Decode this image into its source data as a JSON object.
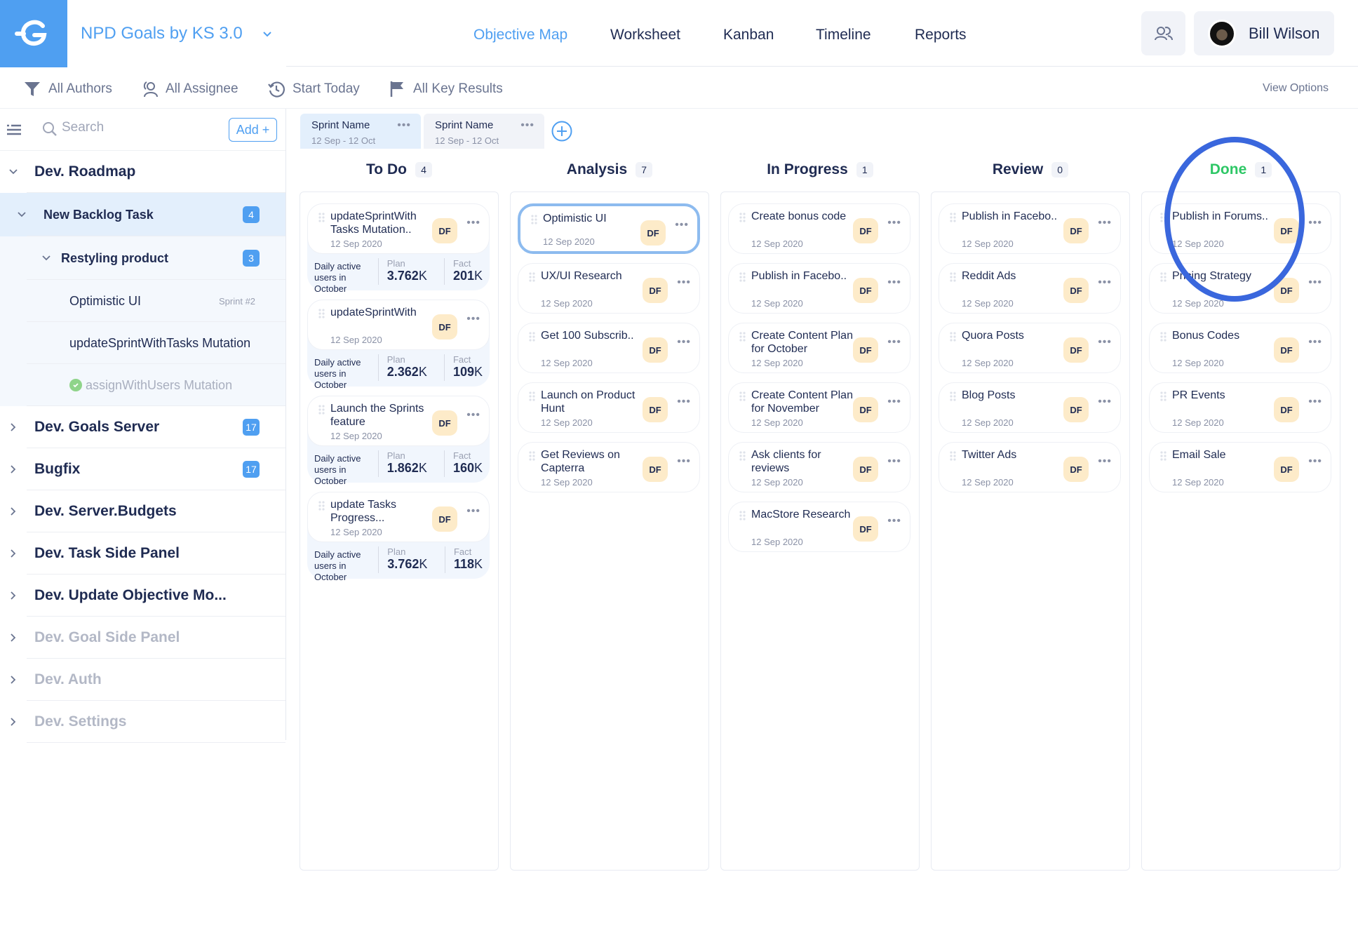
{
  "app": {
    "title": "NPD Goals by KS 3.0",
    "logo_icon": "goals-logo-icon"
  },
  "nav": {
    "tabs": [
      {
        "label": "Objective Map",
        "active": true
      },
      {
        "label": "Worksheet",
        "active": false
      },
      {
        "label": "Kanban",
        "active": false
      },
      {
        "label": "Timeline",
        "active": false
      },
      {
        "label": "Reports",
        "active": false
      }
    ]
  },
  "user": {
    "name": "Bill Wilson",
    "team_icon": "team-icon"
  },
  "filters": {
    "authors": "All Authors",
    "assignee": "All Assignee",
    "start": "Start Today",
    "key_results": "All Key Results",
    "view_options": "View Options"
  },
  "sidebar": {
    "search_placeholder": "Search",
    "add_label": "Add +",
    "items": [
      {
        "label": "Dev. Roadmap",
        "expanded": true
      },
      {
        "label": "New Backlog Task",
        "count": "4",
        "expanded": true
      },
      {
        "label": "Restyling product",
        "count": "3",
        "expanded": true
      },
      {
        "label": "Optimistic UI",
        "meta": "Sprint #2"
      },
      {
        "label": "updateSprintWithTasks Mutation"
      },
      {
        "label": "assignWithUsers Mutation",
        "done": true
      },
      {
        "label": "Dev. Goals Server",
        "count": "17"
      },
      {
        "label": "Bugfix",
        "count": "17"
      },
      {
        "label": "Dev. Server.Budgets"
      },
      {
        "label": "Dev. Task Side Panel"
      },
      {
        "label": "Dev. Update Objective Mo..."
      },
      {
        "label": "Dev. Goal Side Panel",
        "dimmed": true
      },
      {
        "label": "Dev. Auth",
        "dimmed": true
      },
      {
        "label": "Dev. Settings",
        "dimmed": true
      }
    ]
  },
  "sprints": [
    {
      "name": "Sprint Name",
      "dates": "12 Sep - 12 Oct",
      "active": true
    },
    {
      "name": "Sprint Name",
      "dates": "12 Sep - 12 Oct",
      "active": false
    }
  ],
  "board": {
    "columns": [
      {
        "title": "To Do",
        "count": "4",
        "cards": [
          {
            "title": "updateSprintWith Tasks Mutation..",
            "date": "12 Sep 2020",
            "assignee": "DF",
            "kr": {
              "label": "Daily active users in October",
              "plan_label": "Plan",
              "plan_value": "3.762",
              "plan_unit": "K",
              "fact_label": "Fact",
              "fact_value": "201",
              "fact_unit": "K"
            }
          },
          {
            "title": "updateSprintWith",
            "date": "12 Sep 2020",
            "assignee": "DF",
            "kr": {
              "label": "Daily active users in October",
              "plan_label": "Plan",
              "plan_value": "2.362",
              "plan_unit": "K",
              "fact_label": "Fact",
              "fact_value": "109",
              "fact_unit": "K"
            }
          },
          {
            "title": "Launch the Sprints feature",
            "date": "12 Sep 2020",
            "assignee": "DF",
            "kr": {
              "label": "Daily active users in October",
              "plan_label": "Plan",
              "plan_value": "1.862",
              "plan_unit": "K",
              "fact_label": "Fact",
              "fact_value": "160",
              "fact_unit": "K"
            }
          },
          {
            "title": "update Tasks Progress...",
            "date": "12 Sep 2020",
            "assignee": "DF",
            "kr": {
              "label": "Daily active users in October",
              "plan_label": "Plan",
              "plan_value": "3.762",
              "plan_unit": "K",
              "fact_label": "Fact",
              "fact_value": "118",
              "fact_unit": "K"
            }
          }
        ]
      },
      {
        "title": "Analysis",
        "count": "7",
        "cards": [
          {
            "title": "Optimistic UI",
            "date": "12 Sep 2020",
            "assignee": "DF",
            "selected": true
          },
          {
            "title": "UX/UI Research",
            "date": "12 Sep 2020",
            "assignee": "DF"
          },
          {
            "title": "Get 100 Subscrib..",
            "date": "12 Sep 2020",
            "assignee": "DF"
          },
          {
            "title": "Launch on Product Hunt",
            "date": "12 Sep 2020",
            "assignee": "DF"
          },
          {
            "title": "Get Reviews on Capterra",
            "date": "12 Sep 2020",
            "assignee": "DF"
          }
        ]
      },
      {
        "title": "In Progress",
        "count": "1",
        "cards": [
          {
            "title": "Create bonus code",
            "date": "12 Sep 2020",
            "assignee": "DF"
          },
          {
            "title": "Publish in Facebo..",
            "date": "12 Sep 2020",
            "assignee": "DF"
          },
          {
            "title": "Create Content Plan for October",
            "date": "12 Sep 2020",
            "assignee": "DF"
          },
          {
            "title": "Create Content Plan for November",
            "date": "12 Sep 2020",
            "assignee": "DF"
          },
          {
            "title": "Ask clients for reviews",
            "date": "12 Sep 2020",
            "assignee": "DF"
          },
          {
            "title": "MacStore Research",
            "date": "12 Sep 2020",
            "assignee": "DF"
          }
        ]
      },
      {
        "title": "Review",
        "count": "0",
        "cards": [
          {
            "title": "Publish in Facebo..",
            "date": "12 Sep 2020",
            "assignee": "DF"
          },
          {
            "title": "Reddit Ads",
            "date": "12 Sep 2020",
            "assignee": "DF"
          },
          {
            "title": "Quora Posts",
            "date": "12 Sep 2020",
            "assignee": "DF"
          },
          {
            "title": "Blog Posts",
            "date": "12 Sep 2020",
            "assignee": "DF"
          },
          {
            "title": "Twitter Ads",
            "date": "12 Sep 2020",
            "assignee": "DF"
          }
        ]
      },
      {
        "title": "Done",
        "count": "1",
        "highlight_color": "#2ec766",
        "cards": [
          {
            "title": "Publish in Forums..",
            "date": "12 Sep 2020",
            "assignee": "DF"
          },
          {
            "title": "Pricing Strategy",
            "date": "12 Sep 2020",
            "assignee": "DF"
          },
          {
            "title": "Bonus Codes",
            "date": "12 Sep 2020",
            "assignee": "DF"
          },
          {
            "title": "PR Events",
            "date": "12 Sep 2020",
            "assignee": "DF"
          },
          {
            "title": "Email Sale",
            "date": "12 Sep 2020",
            "assignee": "DF"
          }
        ]
      }
    ]
  },
  "colors": {
    "accent": "#4f9ff1",
    "text": "#1f2b52",
    "done": "#2ec766",
    "avatar_chip": "#fdebc9",
    "annotation": "#3a67dd"
  }
}
